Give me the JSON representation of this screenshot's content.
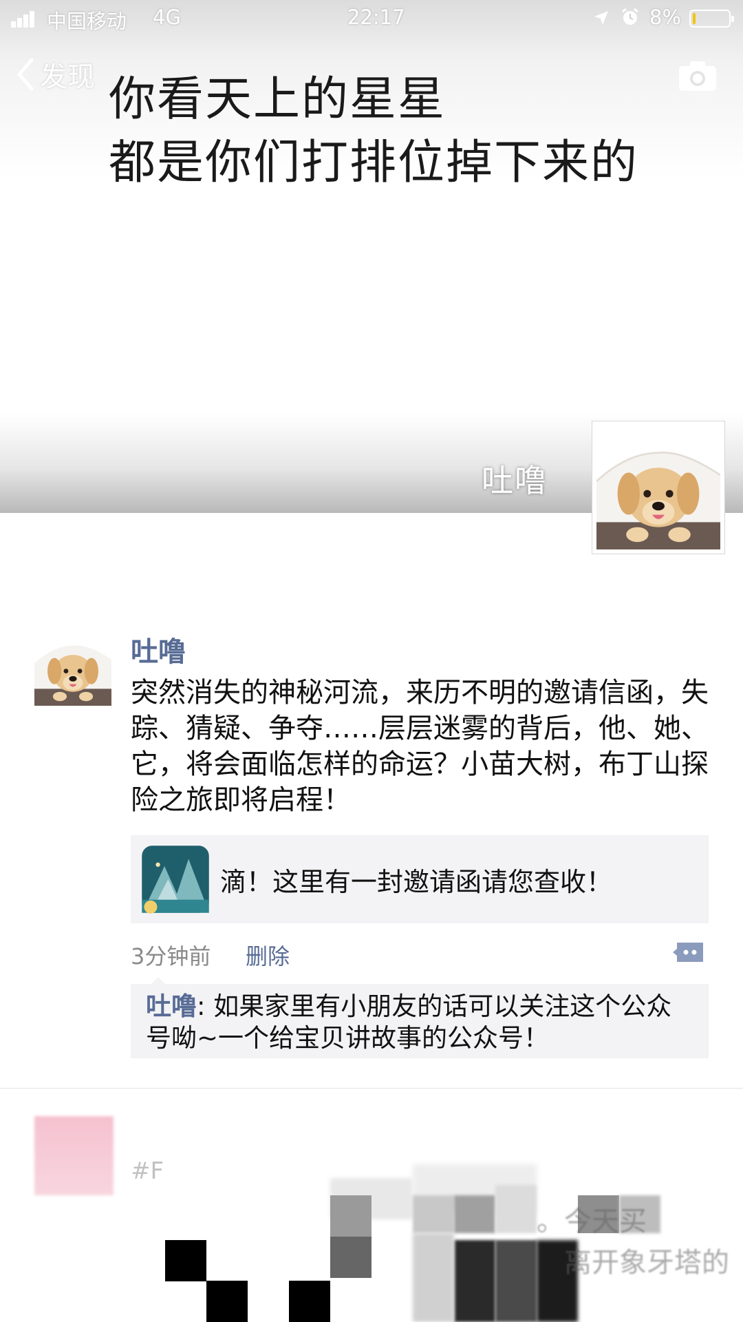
{
  "status_bar": {
    "carrier": "中国移动",
    "network": "4G",
    "time": "22:17",
    "battery_percent": "8%",
    "battery_level": 0.08,
    "battery_color": "#f5c400"
  },
  "nav": {
    "back_label": "发现",
    "back_icon": "chevron-left-icon",
    "camera_icon": "camera-icon"
  },
  "cover": {
    "line1": "你看天上的星星",
    "line2": "都是你们打排位掉下来的"
  },
  "profile": {
    "username": "吐噜"
  },
  "post": {
    "author": "吐噜",
    "body": "突然消失的神秘河流，来历不明的邀请信函，失踪、猜疑、争夺……层层迷雾的背后，他、她、它，将会面临怎样的命运？小苗大树，布丁山探险之旅即将启程！",
    "link_title": "滴！这里有一封邀请函请您查收！",
    "time": "3分钟前",
    "delete_label": "删除",
    "comment": {
      "author": "吐噜",
      "separator": ": ",
      "text": "如果家里有小朋友的话可以关注这个公众号呦~一个给宝贝讲故事的公众号！"
    }
  },
  "next_post": {
    "tag_fragment": "#F",
    "snippet1": "。今天买",
    "snippet2": "离开象牙塔的"
  },
  "colors": {
    "link_blue": "#576b95",
    "card_bg": "#f3f3f5"
  }
}
